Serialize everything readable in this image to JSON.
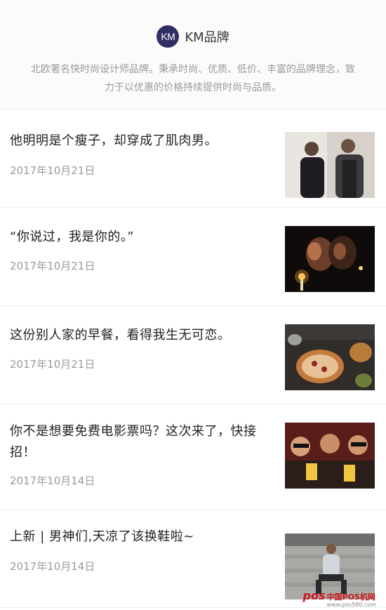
{
  "brand": {
    "avatar_text": "KM",
    "name": "KM品牌",
    "description": "北欧著名快时尚设计师品牌。秉承时尚、优质、低价、丰富的品牌理念，致力于以优惠的价格持续提供时尚与品质。"
  },
  "articles": [
    {
      "title": "他明明是个瘦子，却穿成了肌肉男。",
      "date": "2017年10月21日",
      "thumb_icon": "two-men-photo"
    },
    {
      "title": "“你说过，我是你的。”",
      "date": "2017年10月21日",
      "thumb_icon": "couple-kiss-photo"
    },
    {
      "title": "这份别人家的早餐，看得我生无可恋。",
      "date": "2017年10月21日",
      "thumb_icon": "breakfast-pie-photo"
    },
    {
      "title": "你不是想要免费电影票吗？这次来了，快接招！",
      "date": "2017年10月14日",
      "thumb_icon": "cinema-audience-photo"
    },
    {
      "title": "上新 | 男神们,天凉了该换鞋啦~",
      "date": "2017年10月14日",
      "thumb_icon": "man-on-steps-photo"
    }
  ],
  "watermark": {
    "logo": "pos",
    "text": "中国POS机网",
    "url": "www.pos580.com"
  }
}
